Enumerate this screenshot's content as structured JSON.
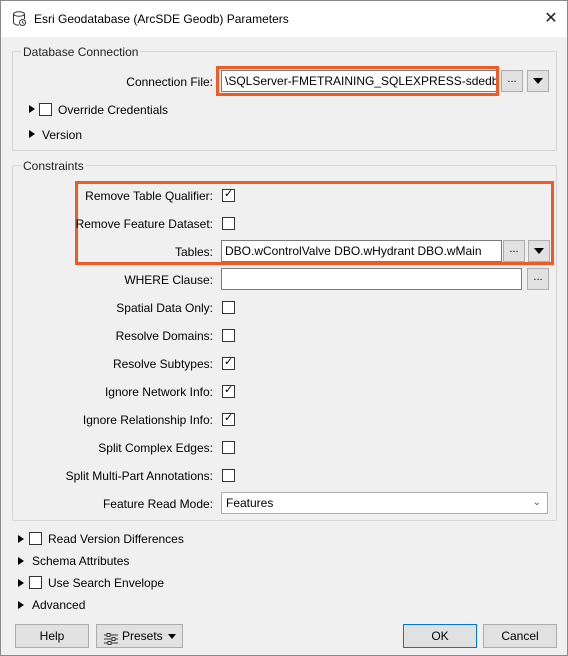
{
  "window": {
    "title": "Esri Geodatabase (ArcSDE Geodb) Parameters"
  },
  "db_connection": {
    "group_label": "Database Connection",
    "connection_file_label": "Connection File:",
    "connection_file_value": "\\SQLServer-FMETRAINING_SQLEXPRESS-sdedb.sde",
    "browse_label": "...",
    "override_credentials_label": "Override Credentials",
    "version_label": "Version"
  },
  "constraints": {
    "group_label": "Constraints",
    "remove_table_qualifier_label": "Remove Table Qualifier:",
    "remove_table_qualifier_checked": true,
    "remove_feature_dataset_label": "Remove Feature Dataset:",
    "remove_feature_dataset_checked": false,
    "tables_label": "Tables:",
    "tables_value": "DBO.wControlValve DBO.wHydrant DBO.wMain",
    "tables_browse": "...",
    "where_clause_label": "WHERE Clause:",
    "where_clause_value": "",
    "where_browse": "...",
    "spatial_data_only_label": "Spatial Data Only:",
    "spatial_data_only_checked": false,
    "resolve_domains_label": "Resolve Domains:",
    "resolve_domains_checked": false,
    "resolve_subtypes_label": "Resolve Subtypes:",
    "resolve_subtypes_checked": true,
    "ignore_network_info_label": "Ignore Network Info:",
    "ignore_network_info_checked": true,
    "ignore_relationship_info_label": "Ignore Relationship Info:",
    "ignore_relationship_info_checked": true,
    "split_complex_edges_label": "Split Complex Edges:",
    "split_complex_edges_checked": false,
    "split_multipart_label": "Split Multi-Part Annotations:",
    "split_multipart_checked": false,
    "feature_read_mode_label": "Feature Read Mode:",
    "feature_read_mode_value": "Features"
  },
  "sections": {
    "read_version_differences": "Read Version Differences",
    "schema_attributes": "Schema Attributes",
    "use_search_envelope": "Use Search Envelope",
    "advanced": "Advanced"
  },
  "footer": {
    "help": "Help",
    "presets": "Presets",
    "ok": "OK",
    "cancel": "Cancel"
  },
  "colors": {
    "highlight": "#f05a23"
  }
}
